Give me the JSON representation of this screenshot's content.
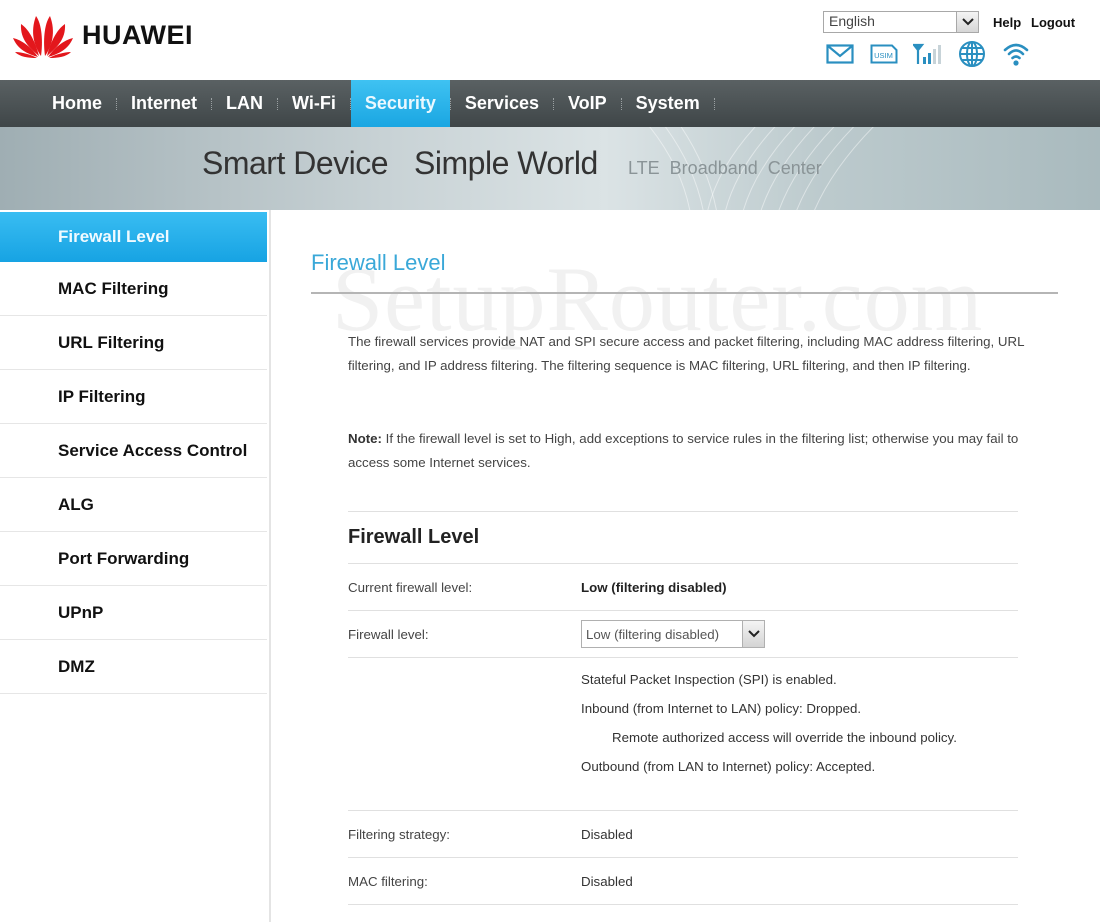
{
  "header": {
    "brand": "HUAWEI",
    "language": {
      "selected": "English"
    },
    "help_label": "Help",
    "logout_label": "Logout",
    "status_icons": [
      "mail-icon",
      "usim-icon",
      "signal-icon",
      "internet-globe-icon",
      "wifi-icon"
    ],
    "usim_label": "USIM"
  },
  "nav": {
    "items": [
      {
        "label": "Home",
        "active": false
      },
      {
        "label": "Internet",
        "active": false
      },
      {
        "label": "LAN",
        "active": false
      },
      {
        "label": "Wi-Fi",
        "active": false
      },
      {
        "label": "Security",
        "active": true
      },
      {
        "label": "Services",
        "active": false
      },
      {
        "label": "VoIP",
        "active": false
      },
      {
        "label": "System",
        "active": false
      }
    ]
  },
  "banner": {
    "slogan_part1": "Smart Device",
    "slogan_part2": "Simple World",
    "subtitle": "LTE  Broadband  Center"
  },
  "sidebar": {
    "items": [
      {
        "label": "Firewall Level",
        "active": true
      },
      {
        "label": "MAC Filtering",
        "active": false
      },
      {
        "label": "URL Filtering",
        "active": false
      },
      {
        "label": "IP Filtering",
        "active": false
      },
      {
        "label": "Service Access Control",
        "active": false
      },
      {
        "label": "ALG",
        "active": false
      },
      {
        "label": "Port Forwarding",
        "active": false
      },
      {
        "label": "UPnP",
        "active": false
      },
      {
        "label": "DMZ",
        "active": false
      }
    ]
  },
  "main": {
    "watermark": "SetupRouter.com",
    "page_title": "Firewall Level",
    "description": "The firewall services provide NAT and SPI secure access and packet filtering, including MAC address filtering, URL filtering, and IP address filtering. The filtering sequence is MAC filtering, URL filtering, and then IP filtering.",
    "note_label": "Note:",
    "note_text": " If the firewall level is set to High, add exceptions to service rules in the filtering list; otherwise you may fail to access some Internet services.",
    "section_title": "Firewall Level",
    "current_level_label": "Current firewall level:",
    "current_level_value": "Low (filtering disabled)",
    "firewall_level_label": "Firewall level:",
    "firewall_level_selected": "Low (filtering disabled)",
    "info_lines": [
      "Stateful Packet Inspection (SPI) is enabled.",
      "Inbound (from Internet to LAN) policy: Dropped.",
      "Remote authorized access will override the inbound policy.",
      "Outbound (from LAN to Internet) policy: Accepted."
    ],
    "filtering_strategy_label": "Filtering strategy:",
    "filtering_strategy_value": "Disabled",
    "mac_filtering_label": "MAC filtering:",
    "mac_filtering_value": "Disabled"
  },
  "colors": {
    "accent": "#1aa6e2",
    "nav_bg": "#4a5153",
    "title_blue": "#3aa8d8",
    "brand_red": "#e3171c",
    "icon_blue": "#2a8fc0"
  }
}
